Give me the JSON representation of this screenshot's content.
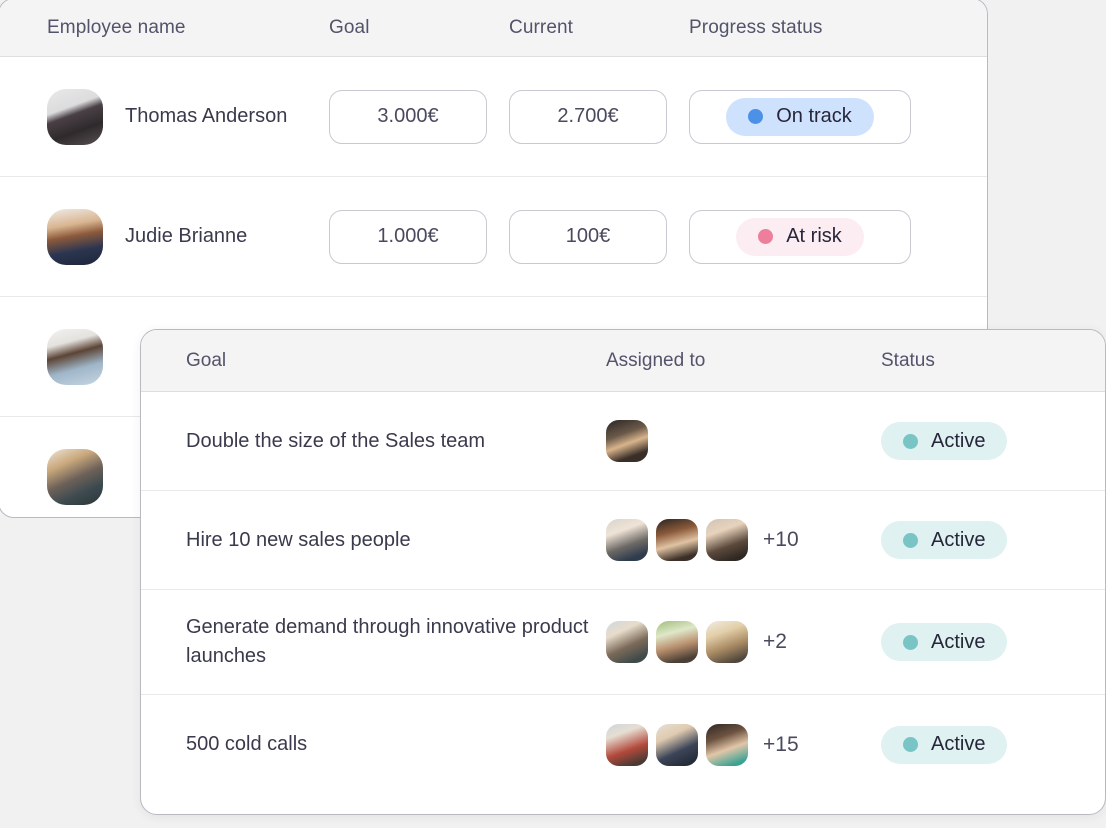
{
  "employee_table": {
    "columns": [
      "Employee name",
      "Goal",
      "Current",
      "Progress status"
    ],
    "rows": [
      {
        "name": "Thomas Anderson",
        "goal": "3.000€",
        "current": "2.700€",
        "status": "On track",
        "status_kind": "ontrack",
        "avatar": "ph-thomas"
      },
      {
        "name": "Judie Brianne",
        "goal": "1.000€",
        "current": "100€",
        "status": "At risk",
        "status_kind": "atrisk",
        "avatar": "ph-judie"
      },
      {
        "name": "",
        "goal": "",
        "current": "",
        "status": "",
        "status_kind": "",
        "avatar": "ph-beard"
      },
      {
        "name": "",
        "goal": "",
        "current": "",
        "status": "",
        "status_kind": "",
        "avatar": "ph-blond"
      }
    ]
  },
  "goal_table": {
    "columns": [
      "Goal",
      "Assigned to",
      "Status"
    ],
    "rows": [
      {
        "goal": "Double the size of the Sales team",
        "assignees": [
          "ph-a1"
        ],
        "more": "",
        "status": "Active",
        "status_kind": "active"
      },
      {
        "goal": "Hire 10 new sales people",
        "assignees": [
          "ph-a2",
          "ph-a3",
          "ph-a4"
        ],
        "more": "+10",
        "status": "Active",
        "status_kind": "active"
      },
      {
        "goal": "Generate demand through innovative product launches",
        "assignees": [
          "ph-a5",
          "ph-a6",
          "ph-a7"
        ],
        "more": "+2",
        "status": "Active",
        "status_kind": "active"
      },
      {
        "goal": "500 cold calls",
        "assignees": [
          "ph-a8",
          "ph-a9",
          "ph-a10"
        ],
        "more": "+15",
        "status": "Active",
        "status_kind": "active"
      }
    ]
  },
  "colors": {
    "page_background": "#f1f1f1",
    "card_background": "#ffffff",
    "card_border": "#b9b9c2",
    "header_background": "#f4f4f5",
    "header_text": "#53536a",
    "body_text": "#3a3a4d",
    "ontrack_bg": "#cfe2fd",
    "ontrack_dot": "#4c91e8",
    "atrisk_bg": "#fcedf2",
    "atrisk_dot": "#ee7f9c",
    "active_bg": "#dff1f0",
    "active_dot": "#79c5c6"
  }
}
